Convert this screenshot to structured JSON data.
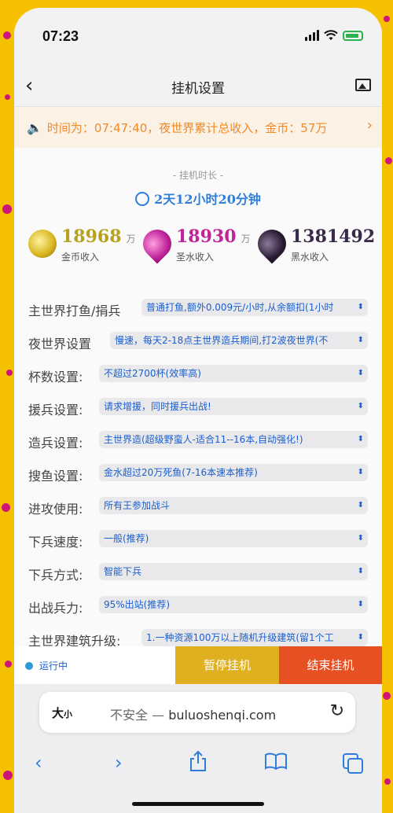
{
  "status_bar": {
    "time": "07:23"
  },
  "nav": {
    "back": "‹",
    "title": "挂机设置"
  },
  "notice": {
    "text": "时间为：07:47:40，夜世界累计总收入，金币：57万",
    "arrow": "›"
  },
  "duration": {
    "label": "- 挂机时长 -",
    "value": "2天12小时20分钟"
  },
  "stats": [
    {
      "value": "18968",
      "unit": "万",
      "label": "金币收入",
      "color": "#b7a21f"
    },
    {
      "value": "18930",
      "unit": "万",
      "label": "圣水收入",
      "color": "#c0249a"
    },
    {
      "value": "1381492",
      "unit": "",
      "label": "黑水收入",
      "color": "#3a2a4a"
    }
  ],
  "settings": [
    {
      "label": "主世界打鱼/捐兵",
      "value": "普通打鱼,额外0.009元/小时,从余额扣(1小时"
    },
    {
      "label": "夜世界设置",
      "value": "慢速，每天2-18点主世界造兵期间,打2波夜世界(不"
    },
    {
      "label": "杯数设置:",
      "value": "不超过2700杯(效率高)"
    },
    {
      "label": "援兵设置:",
      "value": "请求增援，同时援兵出战!"
    },
    {
      "label": "造兵设置:",
      "value": "主世界造(超级野蛮人-适合11--16本,自动强化!)"
    },
    {
      "label": "搜鱼设置:",
      "value": "金水超过20万死鱼(7-16本速本推荐)"
    },
    {
      "label": "进攻使用:",
      "value": "所有王参加战斗"
    },
    {
      "label": "下兵速度:",
      "value": "一般(推荐)"
    },
    {
      "label": "下兵方式:",
      "value": "智能下兵"
    },
    {
      "label": "出战兵力:",
      "value": "95%出站(推荐)"
    },
    {
      "label": "主世界建筑升级:",
      "value": "1.一种资源100万以上随机升级建筑(留1个工"
    }
  ],
  "bottom": {
    "status": "运行中",
    "pause": "暂停挂机",
    "stop": "结束挂机"
  },
  "browser": {
    "size_big": "大",
    "size_small": "小",
    "insecure": "不安全 —",
    "domain": "buluoshenqi.com"
  }
}
